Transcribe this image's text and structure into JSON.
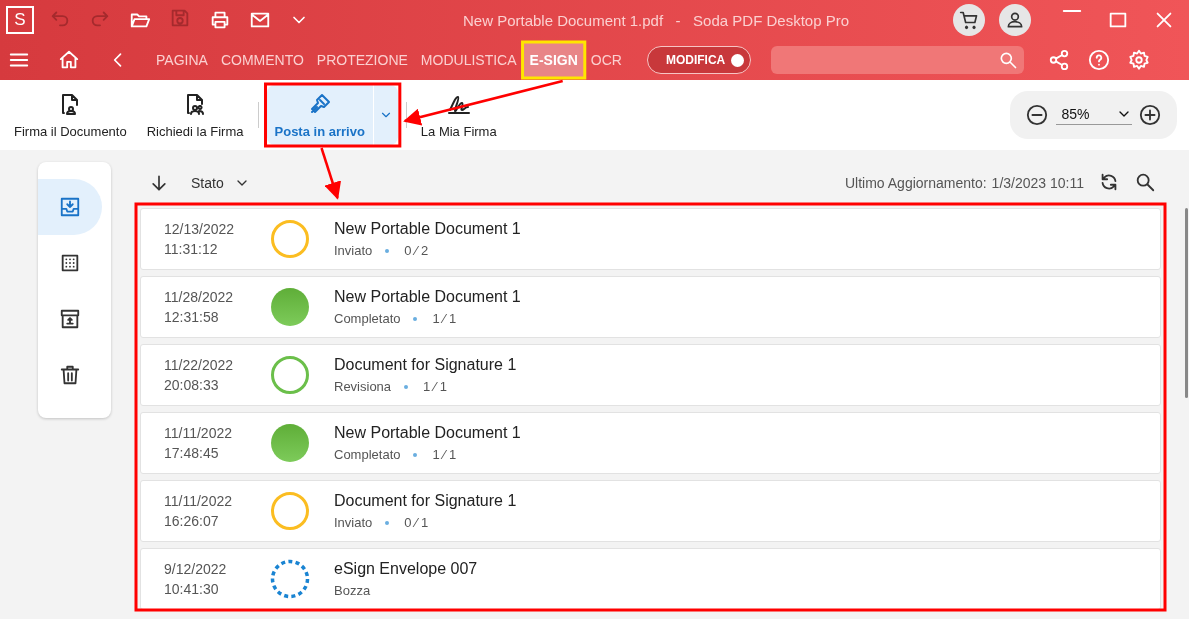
{
  "window": {
    "logo": "S",
    "title": "New Portable Document 1.pdf   -   Soda PDF Desktop Pro"
  },
  "nav": {
    "tabs": [
      {
        "label": "PAGINA",
        "selected": false
      },
      {
        "label": "COMMENTO",
        "selected": false
      },
      {
        "label": "PROTEZIONE",
        "selected": false
      },
      {
        "label": "MODULISTICA",
        "selected": false
      },
      {
        "label": "E-SIGN",
        "selected": true
      },
      {
        "label": "OCR",
        "selected": false
      }
    ],
    "mode_toggle": {
      "label": "MODIFICA",
      "on": true
    }
  },
  "toolbar": {
    "buttons": [
      {
        "kind": "sign",
        "label": "Firma il Documento",
        "selected": false,
        "dropdown": false
      },
      {
        "kind": "request",
        "label": "Richiedi la Firma",
        "selected": false,
        "dropdown": false
      },
      {
        "kind": "inbox",
        "label": "Posta in arrivo",
        "selected": true,
        "dropdown": true
      },
      {
        "kind": "signature",
        "label": "La Mia Firma",
        "selected": false,
        "dropdown": false
      }
    ],
    "zoom": {
      "value": "85%"
    }
  },
  "sidebar": {
    "items": [
      {
        "kind": "inbox",
        "selected": true
      },
      {
        "kind": "grid",
        "selected": false
      },
      {
        "kind": "archive",
        "selected": false
      },
      {
        "kind": "trash",
        "selected": false
      }
    ]
  },
  "list": {
    "sort_label": "Stato",
    "last_update_label": "Ultimo Aggiornamento:",
    "last_update_value": "1/3/2023 10:11",
    "rows": [
      {
        "date": "12/13/2022",
        "time": "11:31:12",
        "kind": "sent",
        "title": "New Portable Document 1",
        "status": "Inviato",
        "count": "0 ⁄ 2"
      },
      {
        "date": "11/28/2022",
        "time": "12:31:58",
        "kind": "completed",
        "title": "New Portable Document 1",
        "status": "Completato",
        "count": "1 ⁄ 1"
      },
      {
        "date": "11/22/2022",
        "time": "20:08:33",
        "kind": "review",
        "title": "Document for Signature 1",
        "status": "Revisiona",
        "count": "1 ⁄ 1"
      },
      {
        "date": "11/11/2022",
        "time": "17:48:45",
        "kind": "completed",
        "title": "New Portable Document 1",
        "status": "Completato",
        "count": "1 ⁄ 1"
      },
      {
        "date": "11/11/2022",
        "time": "16:26:07",
        "kind": "sent",
        "title": "Document for Signature 1",
        "status": "Inviato",
        "count": "0 ⁄ 1"
      },
      {
        "date": "9/12/2022",
        "time": "10:41:30",
        "kind": "draft",
        "title": "eSign Envelope 007",
        "status": "Bozza"
      }
    ]
  }
}
